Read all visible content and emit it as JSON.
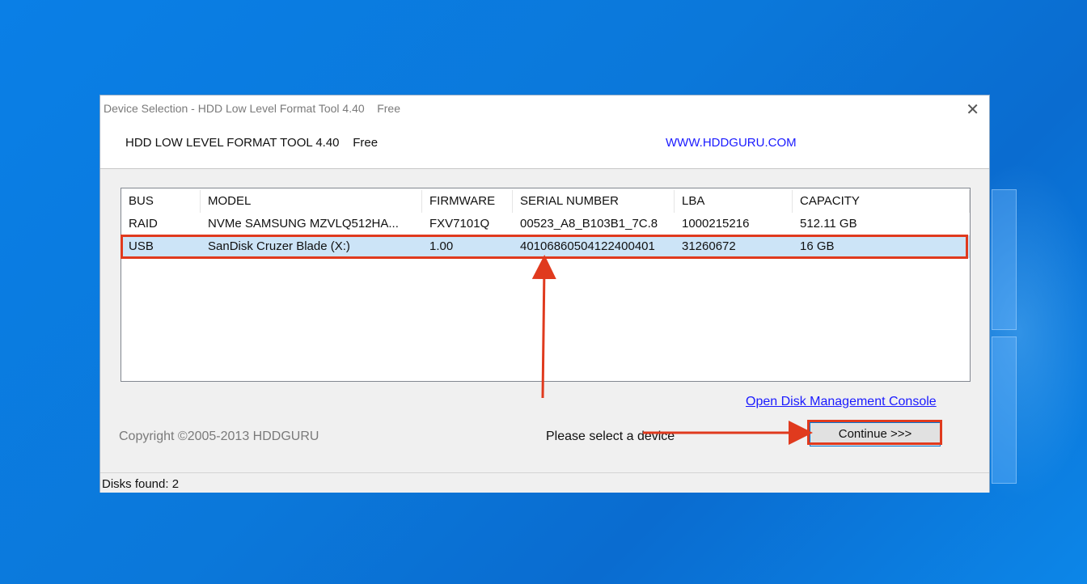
{
  "window": {
    "title": "Device Selection - HDD Low Level Format Tool 4.40    Free",
    "close_glyph": "✕"
  },
  "header": {
    "app_name": "HDD LOW LEVEL FORMAT TOOL 4.40    Free",
    "website": "WWW.HDDGURU.COM"
  },
  "device_table": {
    "columns": [
      "BUS",
      "MODEL",
      "FIRMWARE",
      "SERIAL NUMBER",
      "LBA",
      "CAPACITY"
    ],
    "rows": [
      [
        "RAID",
        "NVMe SAMSUNG MZVLQ512HA...",
        "FXV7101Q",
        "00523_A8_B103B1_7C.8",
        "1000215216",
        "512.11 GB"
      ],
      [
        "USB",
        "SanDisk Cruzer Blade (X:)",
        "1.00",
        "4010686050412240040​1",
        "31260672",
        "16 GB"
      ]
    ],
    "selected_row": 1
  },
  "links": {
    "disk_management": "Open Disk Management Console"
  },
  "footer": {
    "copyright": "Copyright ©2005-2013 HDDGURU",
    "status_message": "Please select a device",
    "continue_label": "Continue >>>"
  },
  "statusbar": {
    "disks_found": "Disks found: 2"
  },
  "colors": {
    "annotation": "#e03a1e",
    "selection": "#cce4f7",
    "link": "#1a1aff",
    "desktop": "#0a7fe6"
  }
}
